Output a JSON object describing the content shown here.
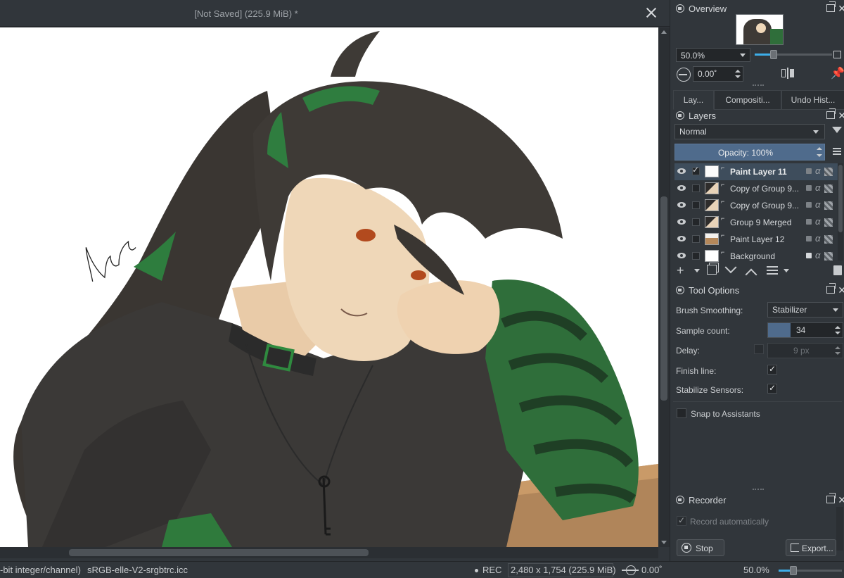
{
  "document": {
    "title": "[Not Saved]  (225.9 MiB) *",
    "signature": "Kiayan"
  },
  "statusbar": {
    "color_info": "-bit integer/channel)",
    "profile": "sRGB-elle-V2-srgbtrc.icc",
    "rec": "REC",
    "image_size": "2,480 x 1,754 (225.9 MiB)",
    "rotation": "0.00˚",
    "zoom": "50.0%",
    "zoom_level": 0.22
  },
  "overview": {
    "title": "Overview",
    "zoom": "50.0%",
    "rotation": "0.00˚",
    "zoom_level": 0.22
  },
  "tabs": [
    "Lay...",
    "Compositi...",
    "Undo Hist..."
  ],
  "layers": {
    "title": "Layers",
    "blend_mode": "Normal",
    "opacity": "Opacity:  100%",
    "items": [
      {
        "name": "Paint Layer 11",
        "selected": true,
        "checked": true,
        "thumb": "paint",
        "lock": false
      },
      {
        "name": "Copy of Group 9...",
        "selected": false,
        "checked": false,
        "thumb": "group",
        "lock": false
      },
      {
        "name": "Copy of Group 9...",
        "selected": false,
        "checked": false,
        "thumb": "group",
        "lock": false
      },
      {
        "name": "Group 9 Merged",
        "selected": false,
        "checked": false,
        "thumb": "group",
        "lock": false
      },
      {
        "name": "Paint Layer 12",
        "selected": false,
        "checked": false,
        "thumb": "orange",
        "lock": false
      },
      {
        "name": "Background",
        "selected": false,
        "checked": false,
        "thumb": "white",
        "lock": true
      }
    ]
  },
  "tool_options": {
    "title": "Tool Options",
    "brush_smoothing_label": "Brush Smoothing:",
    "brush_smoothing_value": "Stabilizer",
    "sample_count_label": "Sample count:",
    "sample_count_value": "34",
    "delay_label": "Delay:",
    "delay_value": "9 px",
    "finish_line_label": "Finish line:",
    "stabilize_sensors_label": "Stabilize Sensors:",
    "snap_label": "Snap to Assistants"
  },
  "recorder": {
    "title": "Recorder",
    "record_auto_label": "Record automatically",
    "stop_label": "Stop",
    "export_label": "Export..."
  },
  "colors": {
    "accent": "#3daee9",
    "opacity_bar": "#4f6b8c",
    "selection": "#3e4d5c"
  }
}
